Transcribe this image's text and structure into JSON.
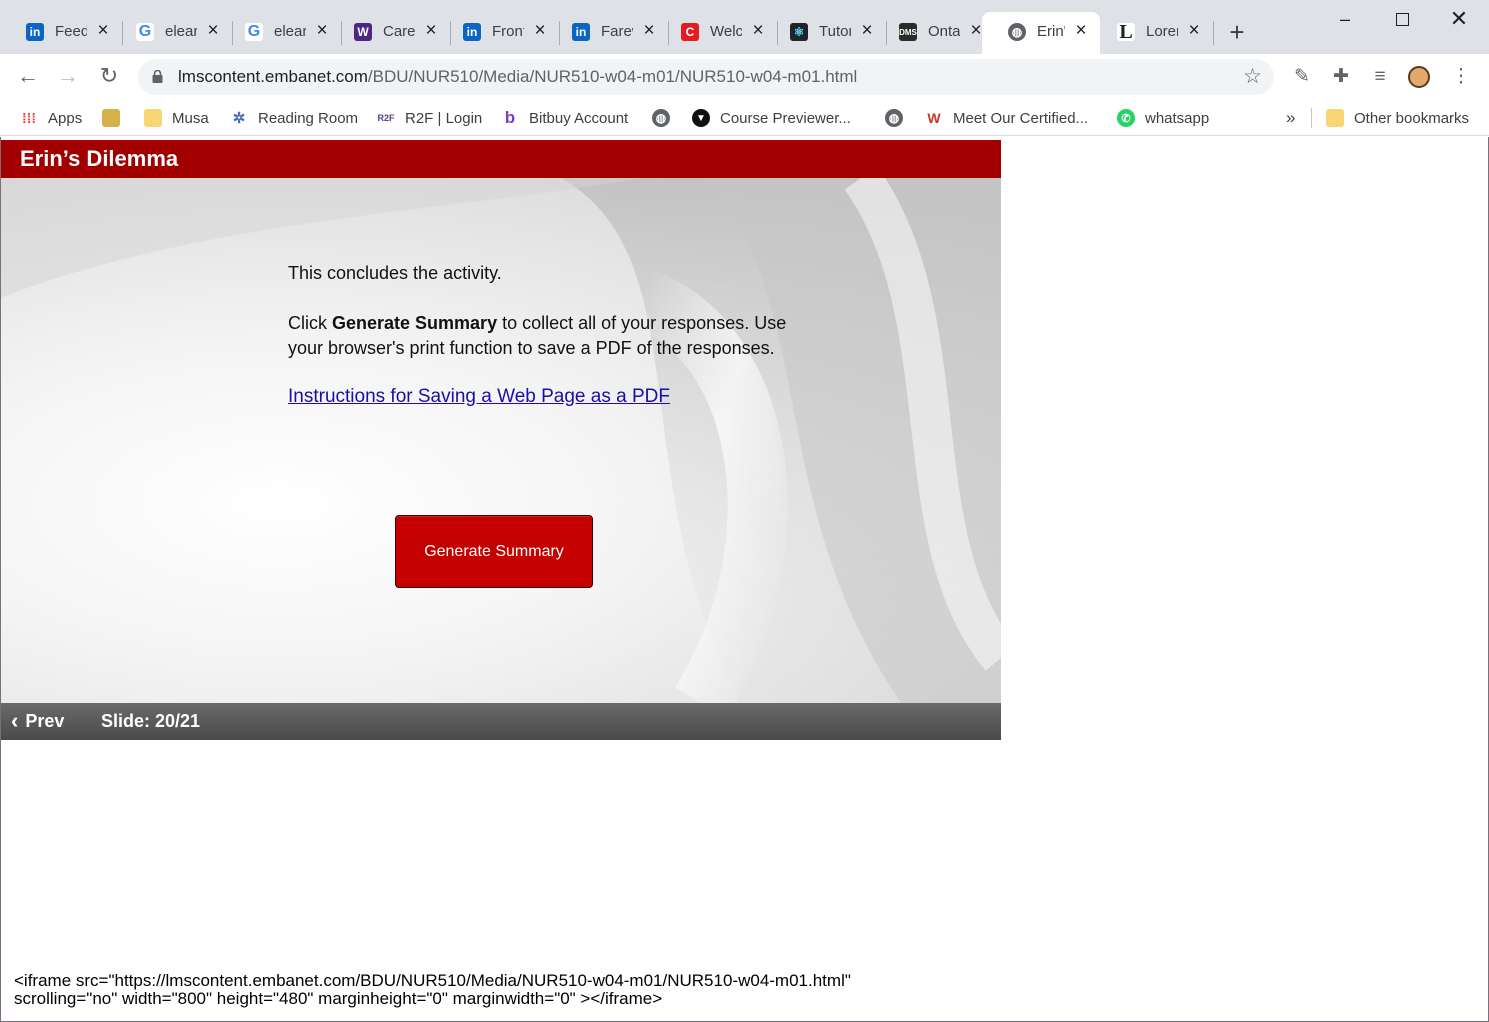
{
  "tabs": [
    {
      "title": "Feed",
      "icon": "linkedin-icon",
      "color": "#0a66c2"
    },
    {
      "title": "elearning",
      "icon": "google-icon",
      "color": "#4285f4"
    },
    {
      "title": "elearning",
      "icon": "google-icon",
      "color": "#4285f4"
    },
    {
      "title": "Careers",
      "icon": "western-crest-icon",
      "color": "#4f2683"
    },
    {
      "title": "Front",
      "icon": "linkedin-icon",
      "color": "#0a66c2"
    },
    {
      "title": "Farewell",
      "icon": "linkedin-icon",
      "color": "#0a66c2"
    },
    {
      "title": "Welcome",
      "icon": "c-logo-icon",
      "color": "#e31b23"
    },
    {
      "title": "Tutorial",
      "icon": "react-icon",
      "color": "#20232a"
    },
    {
      "title": "Ontario",
      "icon": "dms-icon",
      "color": "#2b2b2b"
    },
    {
      "title": "Erin's Dilemma",
      "icon": "globe-icon",
      "color": "#5f6368"
    },
    {
      "title": "Lorem",
      "icon": "l-logo-icon",
      "color": "#202124"
    }
  ],
  "browser": {
    "url_host": "lmscontent.embanet.com",
    "url_path": "/BDU/NUR510/Media/NUR510-w04-m01/NUR510-w04-m01.html"
  },
  "bookmarks": [
    {
      "label": "Apps",
      "icon": "apps-grid-icon"
    },
    {
      "label": "",
      "icon": "turtle-icon"
    },
    {
      "label": "Musa",
      "icon": "folder-icon"
    },
    {
      "label": "Reading Room",
      "icon": "reading-room-icon"
    },
    {
      "label": "R2F | Login",
      "icon": "r2f-icon"
    },
    {
      "label": "Bitbuy Account",
      "icon": "bitbuy-icon"
    },
    {
      "label": "",
      "icon": "globe-icon"
    },
    {
      "label": "Course Previewer...",
      "icon": "previewer-icon"
    },
    {
      "label": "",
      "icon": "globe-icon"
    },
    {
      "label": "Meet Our Certified...",
      "icon": "certified-icon"
    },
    {
      "label": "whatsapp",
      "icon": "whatsapp-icon"
    }
  ],
  "other_bookmarks": "Other bookmarks",
  "page": {
    "title": "Erin’s Dilemma",
    "line1": "This concludes the activity.",
    "click_pre": "Click ",
    "click_bold": "Generate Summary",
    "click_post": " to collect all of your responses. Use",
    "line3": "your browser's print function to save a PDF of the responses.",
    "link": "Instructions for Saving a Web Page as a PDF",
    "button": "Generate Summary",
    "prev": "Prev",
    "slide": "Slide: 20/21"
  },
  "iframe_code_line1": "<iframe src=\"https://lmscontent.embanet.com/BDU/NUR510/Media/NUR510-w04-m01/NUR510-w04-m01.html\"",
  "iframe_code_line2": "scrolling=\"no\" width=\"800\" height=\"480\" marginheight=\"0\" marginwidth=\"0\" ></iframe>"
}
